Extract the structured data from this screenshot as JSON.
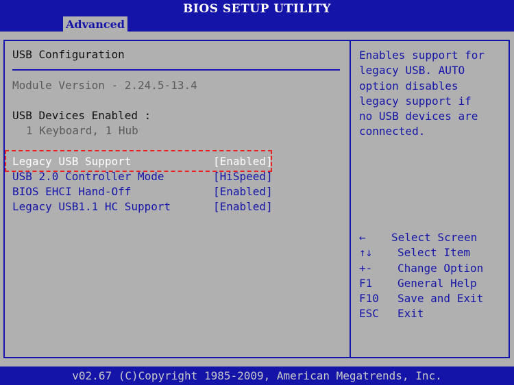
{
  "window": {
    "title": "BIOS SETUP UTILITY",
    "active_tab": "Advanced"
  },
  "section": {
    "title": "USB Configuration",
    "module_version": "Module Version - 2.24.5-13.4",
    "devices_label": "USB Devices Enabled :",
    "devices_value": "1 Keyboard, 1 Hub"
  },
  "settings": [
    {
      "label": "Legacy USB Support",
      "value": "[Enabled]",
      "selected": true
    },
    {
      "label": "USB 2.0 Controller Mode",
      "value": "[HiSpeed]",
      "selected": false
    },
    {
      "label": "BIOS EHCI Hand-Off",
      "value": "[Enabled]",
      "selected": false
    },
    {
      "label": "Legacy USB1.1 HC Support",
      "value": "[Enabled]",
      "selected": false
    }
  ],
  "help_text": [
    "Enables support for",
    "legacy USB. AUTO",
    "option disables",
    "legacy support if",
    "no USB devices are",
    "connected."
  ],
  "keys": [
    {
      "key": "←",
      "desc": "Select Screen"
    },
    {
      "key": "↑↓",
      "desc": "Select Item"
    },
    {
      "key": "+-",
      "desc": "Change Option"
    },
    {
      "key": "F1",
      "desc": "General Help"
    },
    {
      "key": "F10",
      "desc": "Save and Exit"
    },
    {
      "key": "ESC",
      "desc": "Exit"
    }
  ],
  "footer": "v02.67 (C)Copyright 1985-2009, American Megatrends, Inc.",
  "colors": {
    "background": "#b0b0b0",
    "bar": "#1414a8",
    "highlight": "#ffffff",
    "annotation_box": "#e82020"
  }
}
